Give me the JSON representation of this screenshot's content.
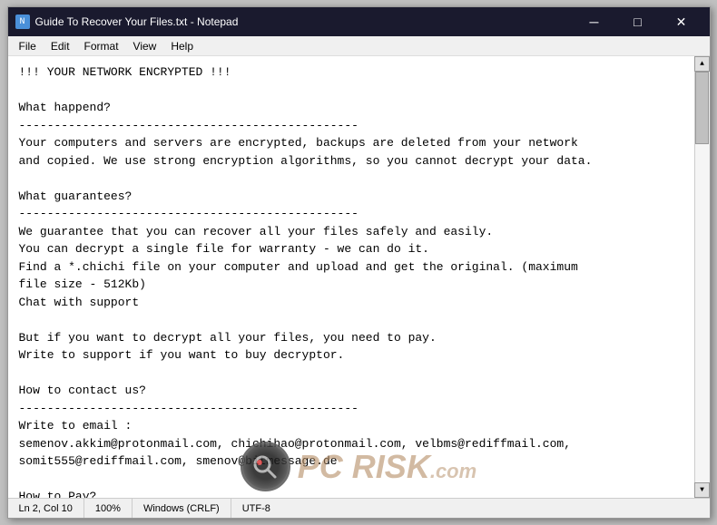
{
  "window": {
    "title": "Guide To Recover Your Files.txt - Notepad",
    "icon_label": "N"
  },
  "title_buttons": {
    "minimize": "─",
    "maximize": "□",
    "close": "✕"
  },
  "menu": {
    "items": [
      "File",
      "Edit",
      "Format",
      "View",
      "Help"
    ]
  },
  "content": {
    "text": "!!! YOUR NETWORK ENCRYPTED !!!\n\nWhat happend?\n------------------------------------------------\nYour computers and servers are encrypted, backups are deleted from your network\nand copied. We use strong encryption algorithms, so you cannot decrypt your data.\n\nWhat guarantees?\n------------------------------------------------\nWe guarantee that you can recover all your files safely and easily.\nYou can decrypt a single file for warranty - we can do it.\nFind a *.chichi file on your computer and upload and get the original. (maximum\nfile size - 512Kb)\nChat with support\n\nBut if you want to decrypt all your files, you need to pay.\nWrite to support if you want to buy decryptor.\n\nHow to contact us?\n------------------------------------------------\nWrite to email :\nsemenov.akkim@protonmail.com, chichihao@protonmail.com, velbms@rediffmail.com,\nsomit555@rediffmail.com, smenov@bitmessage.de\n\nHow to Pay?"
  },
  "status_bar": {
    "position": "Ln 2, Col 10",
    "zoom": "100%",
    "line_endings": "Windows (CRLF)",
    "encoding": "UTF-8"
  },
  "watermark": {
    "text": "PC RISK .com",
    "logo": "🔍"
  }
}
